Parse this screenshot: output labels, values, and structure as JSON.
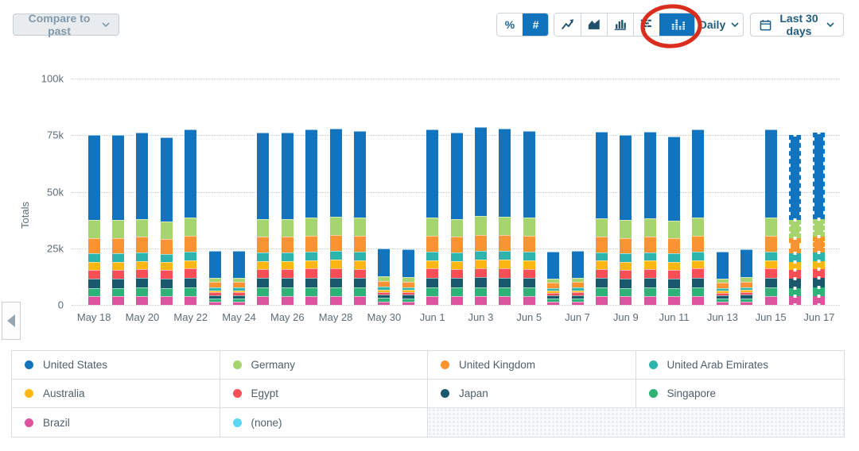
{
  "toolbar": {
    "compare_button": "Compare to past",
    "percent_label": "%",
    "count_label": "#",
    "interval_label": "Daily",
    "date_range_label": "Last 30 days",
    "chart_type_buttons": [
      "line",
      "area",
      "column",
      "stacked-horizontal",
      "stacked-column"
    ],
    "active_chart_type": "stacked-column",
    "active_color": "#1173bc",
    "icons": {
      "line": "line-chart-icon",
      "area": "area-chart-icon",
      "column": "bar-chart-icon",
      "stacked-horizontal": "stacked-horizontal-bar-icon",
      "stacked-column": "stacked-column-chart-icon",
      "calendar": "calendar-icon",
      "chevron": "chevron-down-icon"
    }
  },
  "annotation": {
    "shape": "hand-drawn-ellipse",
    "color": "#da2d1d",
    "highlights": "stacked-column-chart-button"
  },
  "collapse_tab": {
    "direction": "left"
  },
  "chart_data": {
    "type": "bar",
    "stacked": true,
    "ylabel": "Totals",
    "ylim": [
      0,
      100000
    ],
    "yticks": [
      0,
      25000,
      50000,
      75000,
      100000
    ],
    "ytick_labels": [
      "0",
      "25k",
      "50k",
      "75k",
      "100k"
    ],
    "grid": "horizontal-dotted",
    "legend_position": "bottom-table",
    "xtick_every": 2,
    "x": [
      "May 18",
      "May 19",
      "May 20",
      "May 21",
      "May 22",
      "May 23",
      "May 24",
      "May 25",
      "May 26",
      "May 27",
      "May 28",
      "May 29",
      "May 30",
      "May 31",
      "Jun 1",
      "Jun 2",
      "Jun 3",
      "Jun 4",
      "Jun 5",
      "Jun 6",
      "Jun 7",
      "Jun 8",
      "Jun 9",
      "Jun 10",
      "Jun 11",
      "Jun 12",
      "Jun 13",
      "Jun 14",
      "Jun 15",
      "Jun 16",
      "Jun 17"
    ],
    "projected_days": [
      "Jun 16",
      "Jun 17"
    ],
    "series": [
      {
        "name": "United States",
        "color": "#1274bf",
        "values": [
          37500,
          37500,
          38000,
          37000,
          38750,
          12000,
          12000,
          38000,
          38000,
          38750,
          39000,
          38500,
          12500,
          12250,
          38750,
          38000,
          39250,
          39000,
          38500,
          11750,
          12000,
          38250,
          37500,
          38250,
          37250,
          38750,
          11750,
          12250,
          38750,
          37500,
          38000
        ]
      },
      {
        "name": "Germany",
        "color": "#a6d46e",
        "values": [
          7875,
          7875,
          7980,
          7770,
          8138,
          1920,
          1920,
          7980,
          7980,
          8138,
          8190,
          8085,
          2000,
          1960,
          8138,
          7980,
          8243,
          8190,
          8085,
          1880,
          1920,
          8033,
          7875,
          8033,
          7823,
          8138,
          1880,
          1960,
          8138,
          7875,
          7980
        ]
      },
      {
        "name": "United Kingdom",
        "color": "#fa9331",
        "values": [
          6750,
          6750,
          6840,
          6660,
          6975,
          2400,
          2400,
          6840,
          6840,
          6975,
          7020,
          6930,
          2500,
          2450,
          6975,
          6840,
          7065,
          7020,
          6930,
          2350,
          2400,
          6885,
          6750,
          6885,
          6705,
          6975,
          2350,
          2450,
          6975,
          6750,
          6840
        ]
      },
      {
        "name": "United Arab Emirates",
        "color": "#2cb4ad",
        "values": [
          3750,
          3750,
          3800,
          3700,
          3875,
          1200,
          1200,
          3800,
          3800,
          3875,
          3900,
          3850,
          1250,
          1225,
          3875,
          3800,
          3925,
          3900,
          3850,
          1175,
          1200,
          3825,
          3750,
          3825,
          3725,
          3875,
          1175,
          1225,
          3875,
          3750,
          3800
        ]
      },
      {
        "name": "Australia",
        "color": "#fdb712",
        "values": [
          3600,
          3600,
          3648,
          3552,
          3720,
          960,
          960,
          3648,
          3648,
          3720,
          3744,
          3696,
          1000,
          980,
          3720,
          3648,
          3768,
          3744,
          3696,
          940,
          960,
          3672,
          3600,
          3672,
          3576,
          3720,
          940,
          980,
          3720,
          3600,
          3648
        ]
      },
      {
        "name": "Egypt",
        "color": "#f94e55",
        "values": [
          3900,
          3900,
          3952,
          3848,
          4030,
          1200,
          1200,
          3952,
          3952,
          4030,
          4056,
          4004,
          1250,
          1225,
          4030,
          3952,
          4082,
          4056,
          4004,
          1175,
          1200,
          3978,
          3900,
          3978,
          3874,
          4030,
          1175,
          1225,
          4030,
          3900,
          3952
        ]
      },
      {
        "name": "Japan",
        "color": "#1a596d",
        "values": [
          4125,
          4125,
          4180,
          4070,
          4263,
          1440,
          1440,
          4180,
          4180,
          4263,
          4290,
          4235,
          1500,
          1470,
          4263,
          4180,
          4318,
          4290,
          4235,
          1410,
          1440,
          4208,
          4125,
          4208,
          4098,
          4263,
          1410,
          1470,
          4263,
          4125,
          4180
        ]
      },
      {
        "name": "Singapore",
        "color": "#2eb277",
        "values": [
          3750,
          3750,
          3800,
          3700,
          3875,
          1440,
          1440,
          3800,
          3800,
          3875,
          3900,
          3850,
          1500,
          1470,
          3875,
          3800,
          3925,
          3900,
          3850,
          1410,
          1440,
          3825,
          3750,
          3825,
          3725,
          3875,
          1410,
          1470,
          3875,
          3750,
          3800
        ]
      },
      {
        "name": "Brazil",
        "color": "#dc549e",
        "values": [
          3750,
          3750,
          3800,
          3700,
          3875,
          1440,
          1440,
          3800,
          3800,
          3875,
          3900,
          3850,
          1500,
          1470,
          3875,
          3800,
          3925,
          3900,
          3850,
          1410,
          1440,
          3825,
          3750,
          3825,
          3725,
          3875,
          1410,
          1470,
          3875,
          3750,
          3800
        ]
      },
      {
        "name": "(none)",
        "color": "#58d6f4",
        "values": [
          0,
          0,
          0,
          0,
          0,
          0,
          0,
          0,
          0,
          0,
          0,
          0,
          0,
          0,
          0,
          0,
          0,
          0,
          0,
          0,
          0,
          0,
          0,
          0,
          0,
          0,
          0,
          0,
          0,
          0,
          0
        ]
      }
    ]
  }
}
